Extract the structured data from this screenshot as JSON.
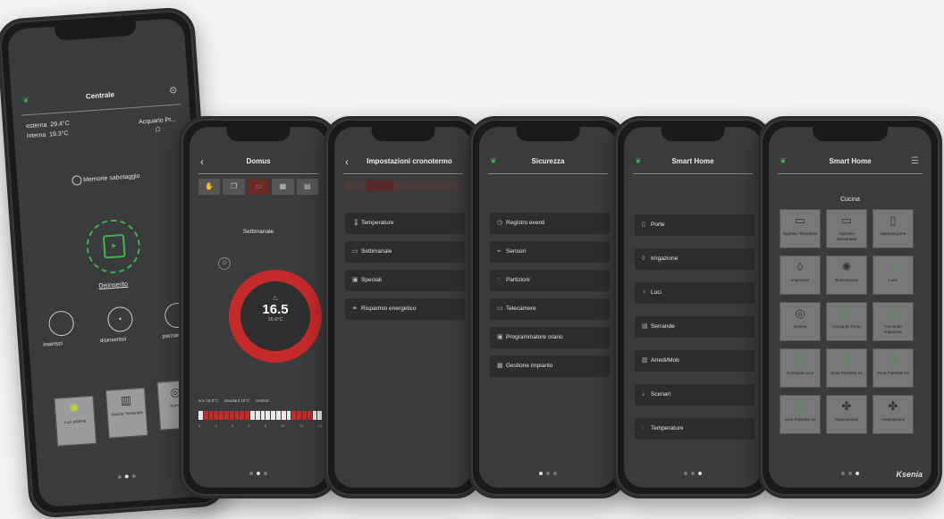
{
  "phone1": {
    "title": "Centrale",
    "temp_ext_label": "esterna",
    "temp_ext_value": "29.4°C",
    "temp_int_label": "interna",
    "temp_int_value": "19.3°C",
    "armed_label": "Acquario Pr...",
    "memory_label": "Memorie sabotaggio",
    "center_label": "Disinserito",
    "modes": [
      "inserisci",
      "disinserisci",
      "parziale"
    ],
    "tiles": [
      "Luci esterne",
      "Vasche Tessartele",
      "Domus"
    ]
  },
  "phone2": {
    "title": "Domus",
    "mode_label": "Settimanale",
    "temperature": "16.5",
    "subtemp": "16.6°C",
    "legend": [
      "eco 16.5°C",
      "standard 19°C",
      "comfort"
    ],
    "hours": [
      "0",
      "2",
      "4",
      "6",
      "8",
      "10",
      "12",
      "14"
    ]
  },
  "phone3": {
    "title": "Impostazioni cronotermo",
    "items": [
      "Temperature",
      "Settimanale",
      "Speciali",
      "Risparmio energetico"
    ]
  },
  "phone4": {
    "title": "Sicurezza",
    "items": [
      "Registro eventi",
      "Sensori",
      "Partizioni",
      "Telecamere",
      "Programmatore orario",
      "Gestione impianto"
    ]
  },
  "phone5": {
    "title": "Smart Home",
    "items": [
      "Porte",
      "Irrigazione",
      "Luci",
      "Serrande",
      "Arredi/Mob",
      "Scenari",
      "Temperature"
    ]
  },
  "phone6": {
    "title": "Smart Home",
    "room": "Cucina",
    "tiles": [
      [
        "Ingresso Tessartele",
        "Ingresso Sessantate",
        "Apertura porta"
      ],
      [
        "Irrigazione",
        "Illuminazione",
        "Luce"
      ],
      [
        "Domus",
        "Comando Porta",
        "Comando Irrigazione"
      ],
      [
        "Comando Luce",
        "Zona Pulsante Sx",
        "Zona Pulsante Dx"
      ],
      [
        "Luce Pulsante Sx",
        "Automazione",
        "Automazione"
      ]
    ]
  },
  "brand": "Ksenia",
  "colors": {
    "accent_green": "#3fb34f",
    "ring_red": "#c42a2a",
    "screen_bg": "#3a3b3d"
  }
}
